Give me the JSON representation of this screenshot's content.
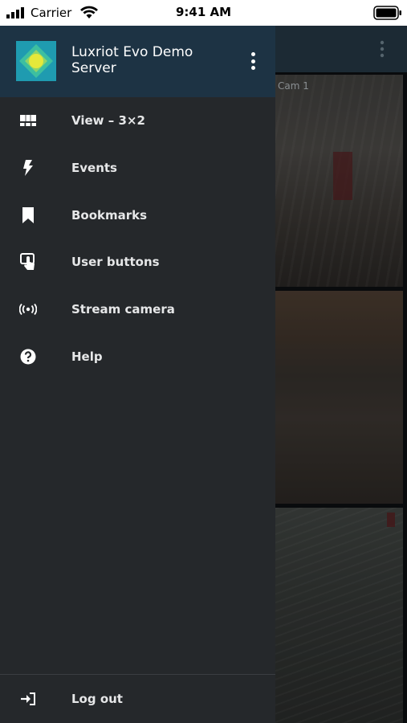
{
  "status_bar": {
    "carrier": "Carrier",
    "time": "9:41 AM"
  },
  "background": {
    "camera_label": "Cam 1"
  },
  "drawer": {
    "server_name": "Luxriot Evo Demo Server",
    "menu": [
      {
        "label": "View – 3×2",
        "icon": "grid-layout-icon"
      },
      {
        "label": "Events",
        "icon": "lightning-icon"
      },
      {
        "label": "Bookmarks",
        "icon": "bookmark-icon"
      },
      {
        "label": "User buttons",
        "icon": "touch-icon"
      },
      {
        "label": "Stream camera",
        "icon": "broadcast-icon"
      },
      {
        "label": "Help",
        "icon": "help-icon"
      }
    ],
    "logout_label": "Log out"
  },
  "colors": {
    "drawer_bg": "#25282b",
    "header_bg": "#1d3344",
    "text": "#e6e7e8"
  }
}
